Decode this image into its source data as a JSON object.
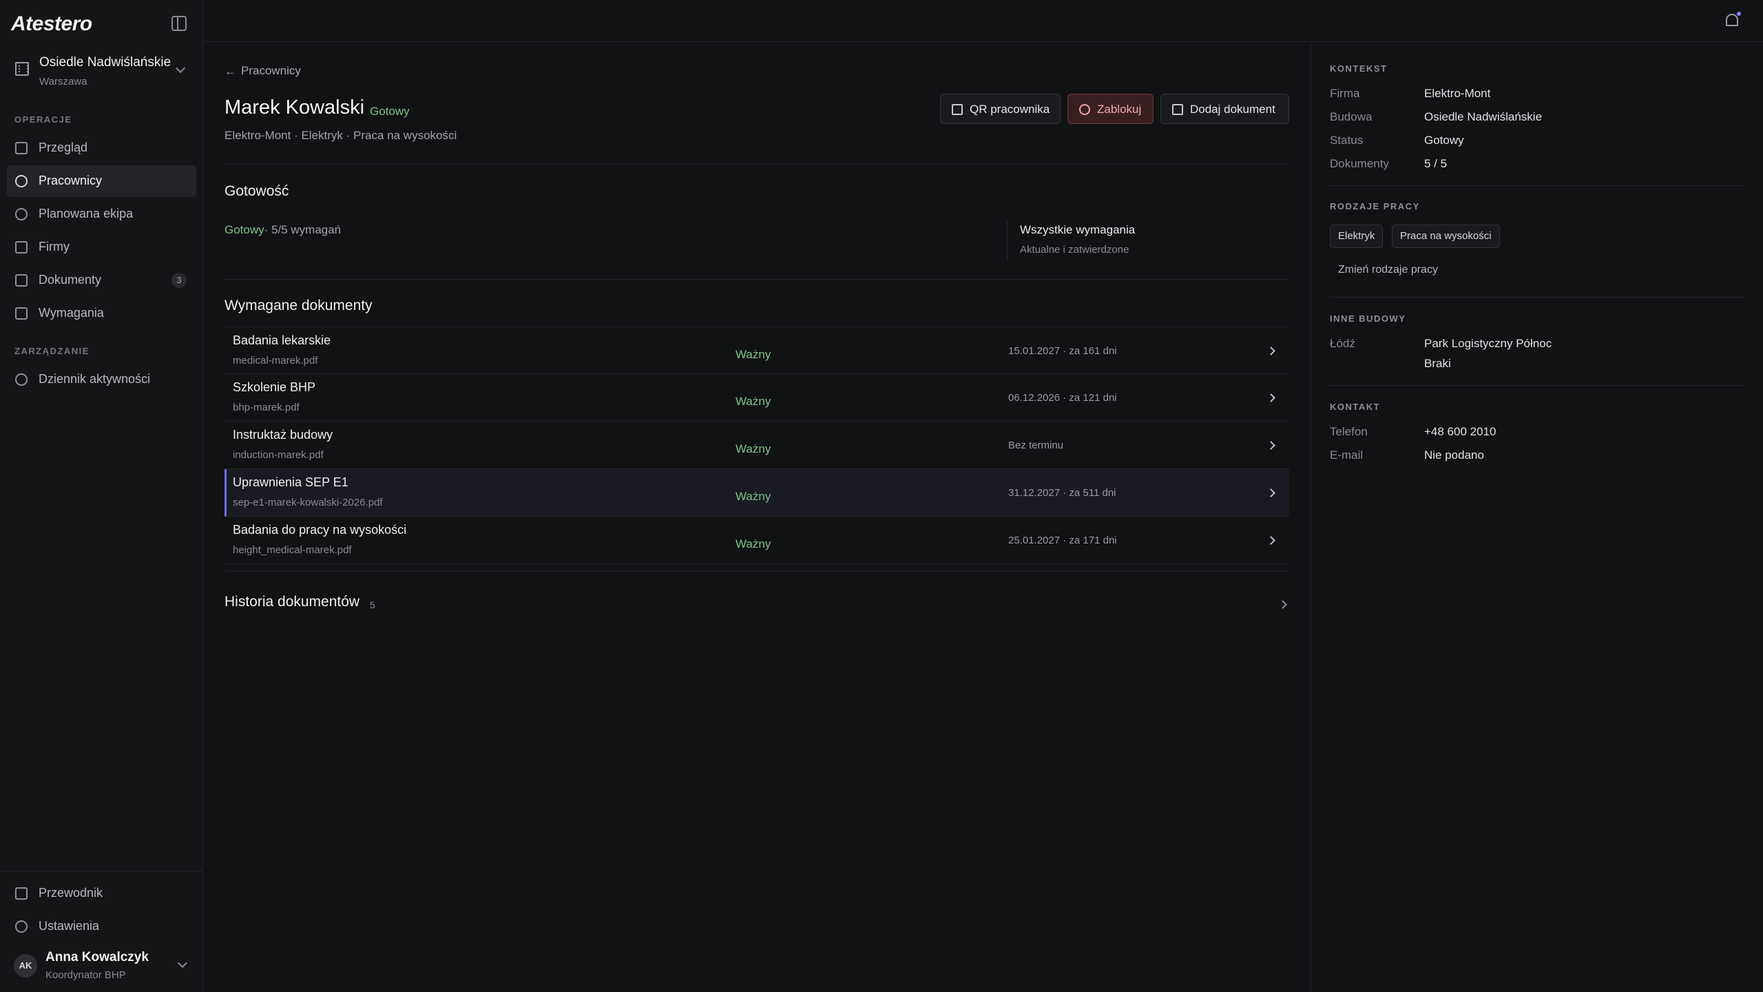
{
  "app": {
    "logo": "Atestero"
  },
  "site": {
    "name": "Osiedle Nadwiślańskie",
    "city": "Warszawa"
  },
  "sidebar": {
    "section_ops": "OPERACJE",
    "section_mgmt": "ZARZĄDZANIE",
    "items": [
      {
        "label": "Przegląd",
        "icon": "grid-icon"
      },
      {
        "label": "Pracownicy",
        "icon": "users-icon",
        "active": true
      },
      {
        "label": "Planowana ekipa",
        "icon": "user-plan-icon"
      },
      {
        "label": "Firmy",
        "icon": "building-icon"
      },
      {
        "label": "Dokumenty",
        "icon": "document-icon",
        "badge": "3"
      },
      {
        "label": "Wymagania",
        "icon": "clipboard-icon"
      },
      {
        "label": "Dziennik aktywności",
        "icon": "history-icon"
      }
    ],
    "bottom": [
      {
        "label": "Przewodnik",
        "icon": "route-icon"
      },
      {
        "label": "Ustawienia",
        "icon": "gear-icon"
      }
    ],
    "user": {
      "initials": "AK",
      "name": "Anna Kowalczyk",
      "role": "Koordynator BHP"
    }
  },
  "main": {
    "back": "Pracownicy",
    "title": "Marek Kowalski",
    "title_status": "Gotowy",
    "subtitle": "Elektro-Mont · Elektryk · Praca na wysokości",
    "buttons": {
      "qr": "QR pracownika",
      "block": "Zablokuj",
      "add": "Dodaj dokument"
    },
    "readiness": {
      "heading": "Gotowość",
      "status": "Gotowy",
      "summary": "· 5/5 wymagań",
      "req_title": "Wszystkie wymagania",
      "req_sub": "Aktualne i zatwierdzone"
    },
    "required_docs": {
      "heading": "Wymagane dokumenty",
      "rows": [
        {
          "name": "Badania lekarskie",
          "file": "medical-marek.pdf",
          "status": "Ważny",
          "date": "15.01.2027 · za 161 dni"
        },
        {
          "name": "Szkolenie BHP",
          "file": "bhp-marek.pdf",
          "status": "Ważny",
          "date": "06.12.2026 · za 121 dni"
        },
        {
          "name": "Instruktaż budowy",
          "file": "induction-marek.pdf",
          "status": "Ważny",
          "date": "Bez terminu"
        },
        {
          "name": "Uprawnienia SEP E1",
          "file": "sep-e1-marek-kowalski-2026.pdf",
          "status": "Ważny",
          "date": "31.12.2027 · za 511 dni"
        },
        {
          "name": "Badania do pracy na wysokości",
          "file": "height_medical-marek.pdf",
          "status": "Ważny",
          "date": "25.01.2027 · za 171 dni"
        }
      ]
    },
    "history": {
      "title": "Historia dokumentów",
      "count": "5"
    }
  },
  "panel": {
    "context": {
      "label": "KONTEKST",
      "rows": [
        {
          "key": "Firma",
          "value": "Elektro-Mont"
        },
        {
          "key": "Budowa",
          "value": "Osiedle Nadwiślańskie"
        },
        {
          "key": "Status",
          "value": "Gotowy"
        },
        {
          "key": "Dokumenty",
          "value": "5 / 5"
        }
      ]
    },
    "work_types": {
      "label": "RODZAJE PRACY",
      "chips": [
        "Elektryk",
        "Praca na wysokości"
      ],
      "change": "Zmień rodzaje pracy"
    },
    "other_sites": {
      "label": "INNE BUDOWY",
      "city": "Łódź",
      "name": "Park Logistyczny Północ",
      "status": "Braki"
    },
    "contact": {
      "label": "KONTAKT",
      "phone_key": "Telefon",
      "phone": "+48 600 2010",
      "email_key": "E-mail",
      "email": "Nie podano"
    }
  },
  "colors": {
    "accent": "#6f6cf0",
    "ok": "#7fc28a",
    "danger": "#e0787a"
  }
}
